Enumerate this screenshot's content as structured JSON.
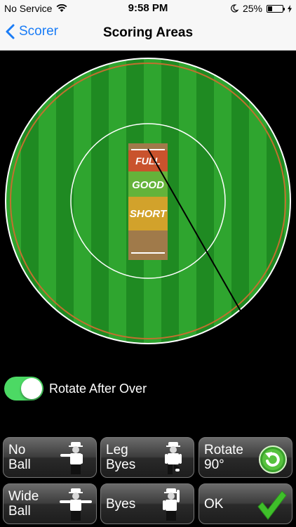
{
  "status_bar": {
    "carrier": "No Service",
    "time": "9:58 PM",
    "battery": "25%"
  },
  "nav": {
    "back_label": "Scorer",
    "title": "Scoring Areas"
  },
  "pitch": {
    "full": "FULL",
    "good": "GOOD",
    "short": "SHORT"
  },
  "toggle": {
    "label": "Rotate After Over",
    "on": true
  },
  "buttons": {
    "no_ball": "No\nBall",
    "leg_byes": "Leg\nByes",
    "rotate": "Rotate\n90°",
    "wide_ball": "Wide\nBall",
    "byes": "Byes",
    "ok": "OK"
  },
  "colors": {
    "accent_blue": "#1a7cf6",
    "toggle_green": "#4cd964",
    "grass_light": "#2fa52f",
    "grass_dark": "#1f8a22",
    "full_zone": "#c9532d",
    "good_zone": "#64b33a",
    "short_zone": "#d2a22b",
    "rest_zone": "#a07a4a"
  },
  "icons": [
    "wifi-icon",
    "moon-icon",
    "battery-icon",
    "chevron-left-icon",
    "umpire-icon",
    "rotate-icon",
    "checkmark-icon"
  ]
}
